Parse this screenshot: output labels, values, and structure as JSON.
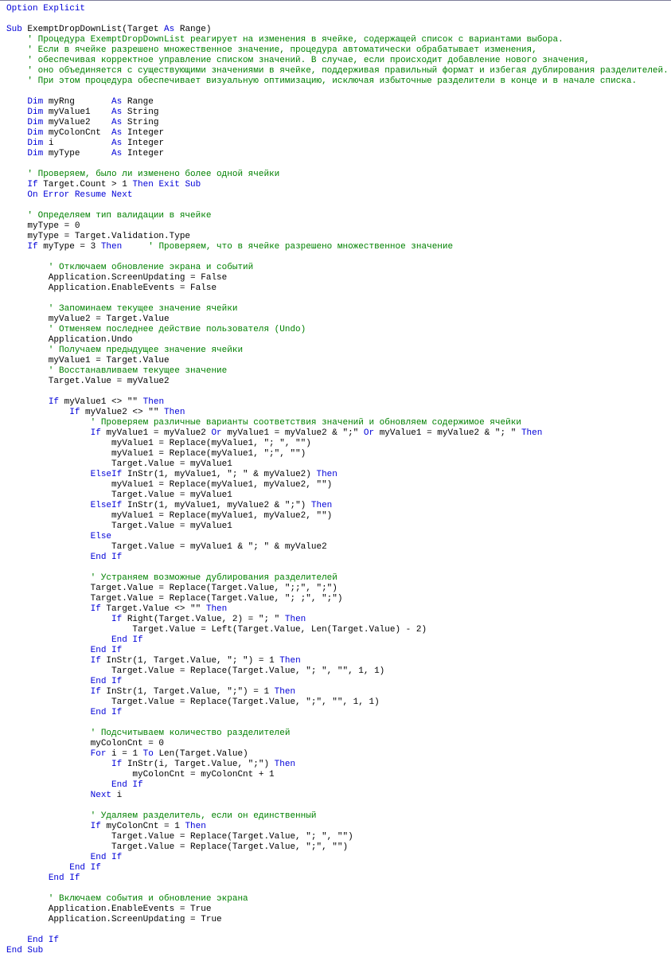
{
  "code": {
    "option_explicit": "Option Explicit",
    "sub_decl": {
      "sub": "Sub",
      "name": " ExemptDropDownList(Target ",
      "as": "As",
      "type": " Range)"
    },
    "comments_top": [
      "    ' Процедура ExemptDropDownList реагирует на изменения в ячейке, содержащей список с вариантами выбора.",
      "    ' Если в ячейке разрешено множественное значение, процедура автоматически обрабатывает изменения,",
      "    ' обеспечивая корректное управление списком значений. В случае, если происходит добавление нового значения,",
      "    ' оно объединяется с существующими значениями в ячейке, поддерживая правильный формат и избегая дублирования разделителей.",
      "    ' При этом процедура обеспечивает визуальную оптимизацию, исключая избыточные разделители в конце и в начале списка."
    ],
    "dims": [
      {
        "dim": "Dim",
        "name": " myRng       ",
        "as": "As",
        "type": " Range"
      },
      {
        "dim": "Dim",
        "name": " myValue1    ",
        "as": "As",
        "type": " String"
      },
      {
        "dim": "Dim",
        "name": " myValue2    ",
        "as": "As",
        "type": " String"
      },
      {
        "dim": "Dim",
        "name": " myColonCnt  ",
        "as": "As",
        "type": " Integer"
      },
      {
        "dim": "Dim",
        "name": " i           ",
        "as": "As",
        "type": " Integer"
      },
      {
        "dim": "Dim",
        "name": " myType      ",
        "as": "As",
        "type": " Integer"
      }
    ],
    "c_check_one": "    ' Проверяем, было ли изменено более одной ячейки",
    "if_count": {
      "if": "If",
      "mid": " Target.Count > 1 ",
      "then": "Then",
      "exit": " Exit Sub"
    },
    "on_error": "    On Error Resume Next",
    "c_valid": "    ' Определяем тип валидации в ячейке",
    "mytype0": "    myType = 0",
    "mytype_assign": "    myType = Target.Validation.Type",
    "if_type3": {
      "if": "If",
      "mid": " myType = 3 ",
      "then": "Then",
      "cm": "     ' Проверяем, что в ячейке разрешено множественное значение"
    },
    "c_off": "        ' Отключаем обновление экрана и событий",
    "screen_off": "        Application.ScreenUpdating = False",
    "events_off": "        Application.EnableEvents = False",
    "c_save": "        ' Запоминаем текущее значение ячейки",
    "val2": "        myValue2 = Target.Value",
    "c_undo": "        ' Отменяем последнее действие пользователя (Undo)",
    "undo": "        Application.Undo",
    "c_prev": "        ' Получаем предыдущее значение ячейки",
    "val1": "        myValue1 = Target.Value",
    "c_restore": "        ' Восстанавливаем текущее значение",
    "restore": "        Target.Value = myValue2",
    "if_v1": {
      "if": "If",
      "mid": " myValue1 <> \"\" ",
      "then": "Then"
    },
    "if_v2": {
      "if": "If",
      "mid": " myValue2 <> \"\" ",
      "then": "Then"
    },
    "c_match": "                ' Проверяем различные варианты соответствия значений и обновляем содержимое ячейки",
    "if_match": {
      "if": "If",
      "a": " myValue1 = myValue2 ",
      "or1": "Or",
      "b": " myValue1 = myValue2 & \";\" ",
      "or2": "Or",
      "c": " myValue1 = myValue2 & \"; \" ",
      "then": "Then"
    },
    "r1": "                    myValue1 = Replace(myValue1, \"; \", \"\")",
    "r2": "                    myValue1 = Replace(myValue1, \";\", \"\")",
    "tv1": "                    Target.Value = myValue1",
    "elseif1": {
      "ei": "ElseIf",
      "mid": " InStr(1, myValue1, \"; \" & myValue2) ",
      "then": "Then"
    },
    "r3": "                    myValue1 = Replace(myValue1, myValue2, \"\")",
    "tv2": "                    Target.Value = myValue1",
    "elseif2": {
      "ei": "ElseIf",
      "mid": " InStr(1, myValue1, myValue2 & \";\") ",
      "then": "Then"
    },
    "r4": "                    myValue1 = Replace(myValue1, myValue2, \"\")",
    "tv3": "                    Target.Value = myValue1",
    "else": "Else",
    "concat": "                    Target.Value = myValue1 & \"; \" & myValue2",
    "endif1": "End If",
    "c_dup": "                ' Устраняем возможные дублирования разделителей",
    "d1": "                Target.Value = Replace(Target.Value, \";;\", \";\")",
    "d2": "                Target.Value = Replace(Target.Value, \"; ;\", \";\")",
    "if_ne": {
      "if": "If",
      "mid": " Target.Value <> \"\" ",
      "then": "Then"
    },
    "if_right": {
      "if": "If",
      "mid": " Right(Target.Value, 2) = \"; \" ",
      "then": "Then"
    },
    "left": "                        Target.Value = Left(Target.Value, Len(Target.Value) - 2)",
    "endif2": "End If",
    "endif3": "End If",
    "if_instr1": {
      "if": "If",
      "mid": " InStr(1, Target.Value, \"; \") = 1 ",
      "then": "Then"
    },
    "repl1": "                    Target.Value = Replace(Target.Value, \"; \", \"\", 1, 1)",
    "endif4": "End If",
    "if_instr2": {
      "if": "If",
      "mid": " InStr(1, Target.Value, \";\") = 1 ",
      "then": "Then"
    },
    "repl2": "                    Target.Value = Replace(Target.Value, \";\", \"\", 1, 1)",
    "endif5": "End If",
    "c_count": "                ' Подсчитываем количество разделителей",
    "cnt0": "                myColonCnt = 0",
    "for": {
      "for": "For",
      "a": " i = 1 ",
      "to": "To",
      "b": " Len(Target.Value)"
    },
    "if_cnt": {
      "if": "If",
      "mid": " InStr(i, Target.Value, \";\") ",
      "then": "Then"
    },
    "inc": "                        myColonCnt = myColonCnt + 1",
    "endif6": "End If",
    "next": {
      "next": "Next",
      "i": " i"
    },
    "c_del1": "                ' Удаляем разделитель, если он единственный",
    "if_one": {
      "if": "If",
      "mid": " myColonCnt = 1 ",
      "then": "Then"
    },
    "dd1": "                    Target.Value = Replace(Target.Value, \"; \", \"\")",
    "dd2": "                    Target.Value = Replace(Target.Value, \";\", \"\")",
    "endif7": "End If",
    "endif8": "End If",
    "endif9": "End If",
    "c_on": "        ' Включаем события и обновление экрана",
    "ev_on": "        Application.EnableEvents = True",
    "sc_on": "        Application.ScreenUpdating = True",
    "endif10": "End If",
    "end_sub": "End Sub"
  }
}
